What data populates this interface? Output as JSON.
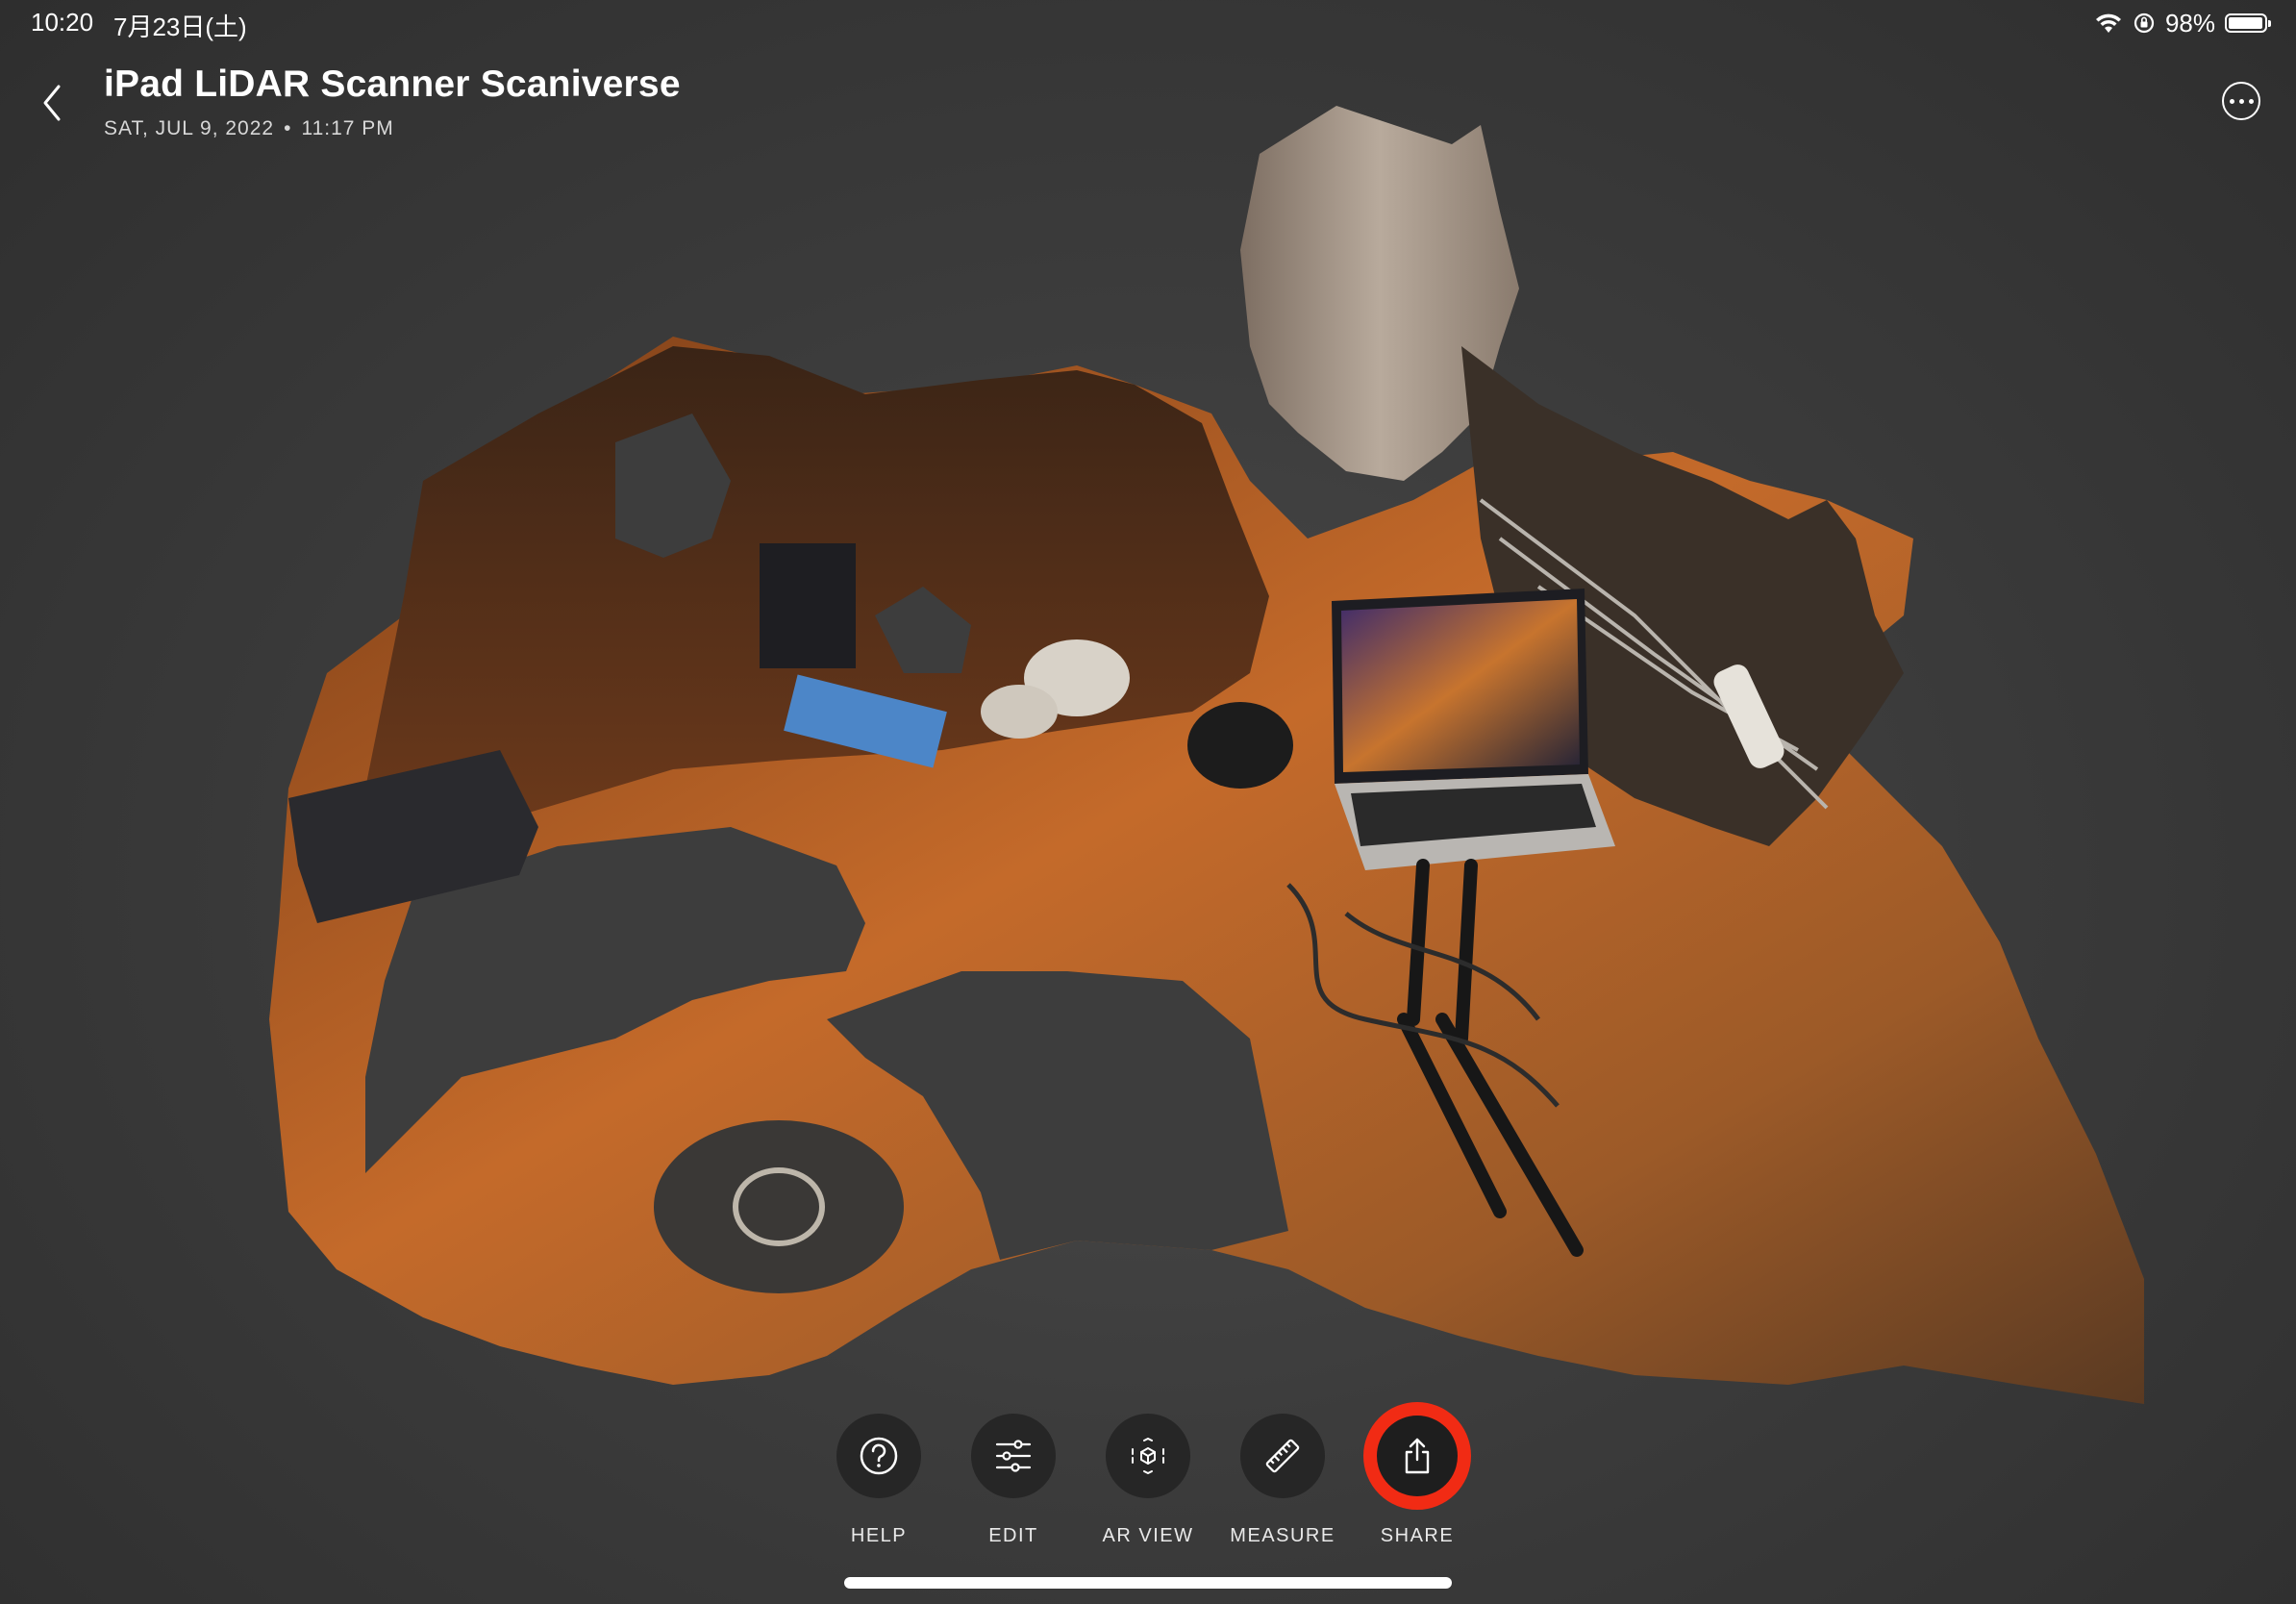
{
  "status_bar": {
    "time": "10:20",
    "date": "7月23日(土)",
    "battery_text": "98%",
    "battery_level": 0.98,
    "icons": [
      "wifi-icon",
      "orientation-lock-icon",
      "battery-icon"
    ]
  },
  "header": {
    "back_icon": "chevron-left-icon",
    "title": "iPad LiDAR Scanner Scaniverse",
    "date": "SAT, JUL 9, 2022",
    "separator": "•",
    "time": "11:17 PM",
    "more_icon": "ellipsis-circle-icon"
  },
  "scan_view": {
    "subject": "3D LiDAR scan mesh"
  },
  "toolbar": {
    "items": [
      {
        "label": "HELP",
        "icon": "question-mark-icon"
      },
      {
        "label": "EDIT",
        "icon": "sliders-icon"
      },
      {
        "label": "AR VIEW",
        "icon": "ar-cube-icon"
      },
      {
        "label": "MEASURE",
        "icon": "ruler-icon"
      },
      {
        "label": "SHARE",
        "icon": "share-icon"
      }
    ],
    "highlight_color": "#f12b14"
  }
}
